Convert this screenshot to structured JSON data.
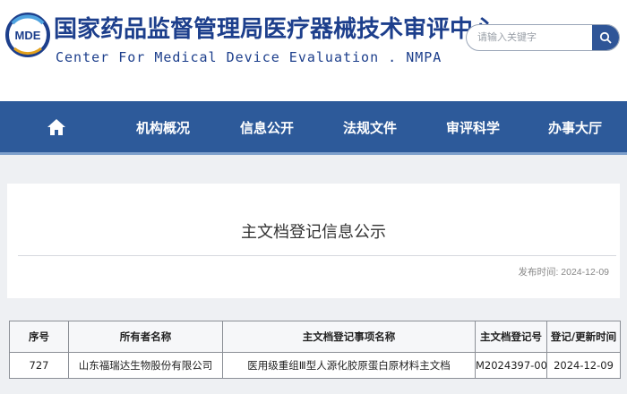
{
  "header": {
    "logo_text": "MDE",
    "title": "国家药品监督管理局医疗器械技术审评中心",
    "subtitle": "Center For Medical Device Evaluation . NMPA"
  },
  "search": {
    "placeholder": "请输入关键字",
    "icon": "search-icon"
  },
  "nav": {
    "home_icon": "home-icon",
    "items": [
      "机构概况",
      "信息公开",
      "法规文件",
      "审评科学",
      "办事大厅"
    ]
  },
  "notice": {
    "title": "主文档登记信息公示",
    "publish_label": "发布时间: 2024-12-09"
  },
  "table": {
    "headers": [
      "序号",
      "所有者名称",
      "主文档登记事项名称",
      "主文档登记号",
      "登记/更新时间"
    ],
    "rows": [
      [
        "727",
        "山东福瑞达生物股份有限公司",
        "医用级重组Ⅲ型人源化胶原蛋白原材料主文档",
        "M2024397-000",
        "2024-12-09"
      ]
    ]
  },
  "colors": {
    "brand": "#1d3f8c",
    "nav_bg": "#2d5a9a"
  }
}
